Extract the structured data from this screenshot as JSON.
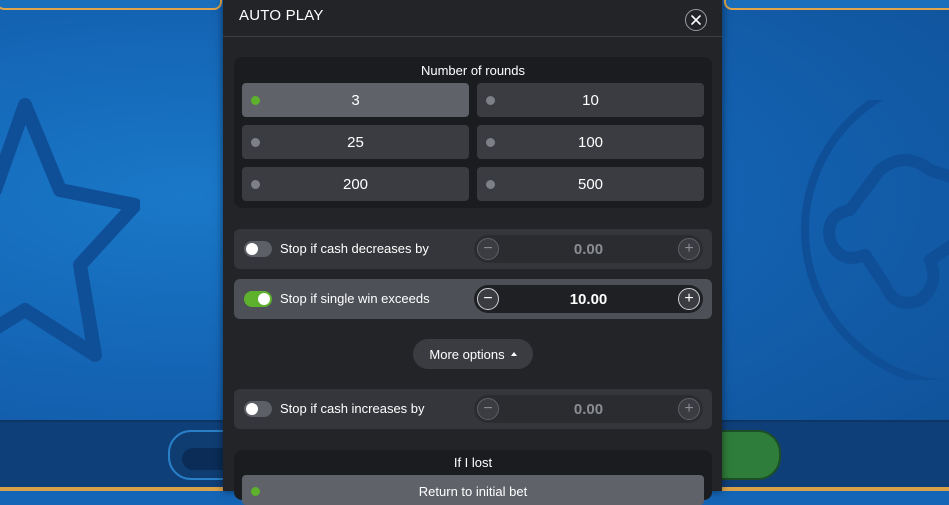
{
  "panel": {
    "title": "AUTO PLAY"
  },
  "rounds": {
    "label": "Number of rounds",
    "options": [
      "3",
      "10",
      "25",
      "100",
      "200",
      "500"
    ],
    "selected": "3"
  },
  "stop_cash_decrease": {
    "label": "Stop if cash decreases by",
    "enabled": false,
    "value": "0.00"
  },
  "stop_single_win": {
    "label": "Stop if single win exceeds",
    "enabled": true,
    "value": "10.00"
  },
  "more_options": {
    "label": "More options"
  },
  "stop_cash_increase": {
    "label": "Stop if cash increases by",
    "enabled": false,
    "value": "0.00"
  },
  "if_lost": {
    "label": "If I lost",
    "option": "Return to initial bet"
  },
  "colors": {
    "accent_green": "#5db12c",
    "panel_bg": "#222427",
    "background_blue": "#1565b6"
  }
}
